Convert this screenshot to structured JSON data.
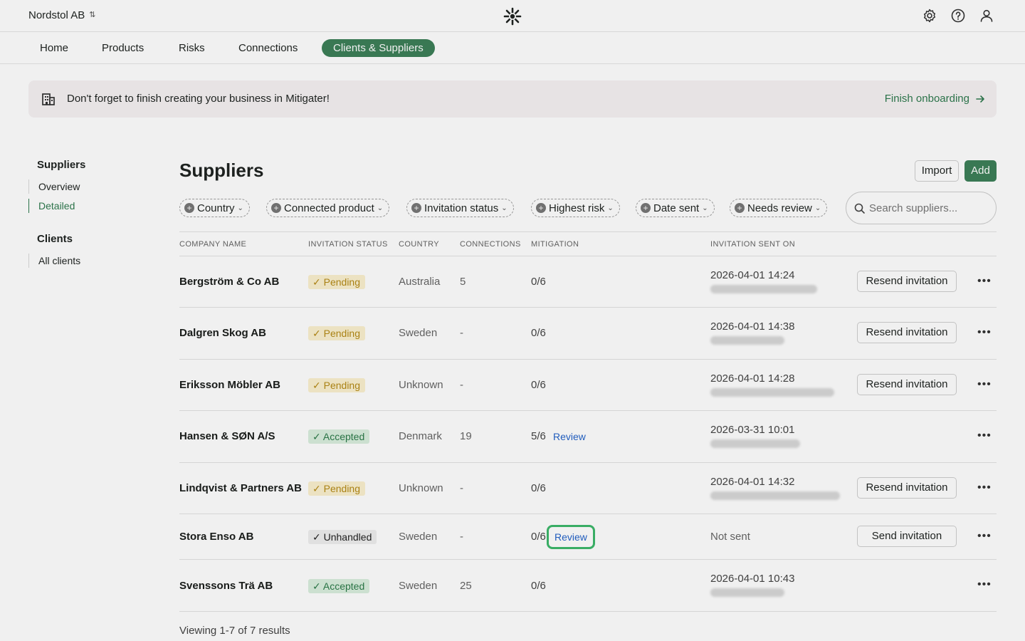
{
  "header": {
    "org_name": "Nordstol AB"
  },
  "nav": {
    "items": [
      "Home",
      "Products",
      "Risks",
      "Connections",
      "Clients & Suppliers"
    ],
    "active": "Clients & Suppliers"
  },
  "banner": {
    "text": "Don't forget to finish creating your business in Mitigater!",
    "link_label": "Finish onboarding"
  },
  "sidebar": {
    "suppliers_title": "Suppliers",
    "suppliers_items": [
      "Overview",
      "Detailed"
    ],
    "clients_title": "Clients",
    "clients_items": [
      "All clients"
    ]
  },
  "main": {
    "title": "Suppliers",
    "import_label": "Import",
    "add_label": "Add",
    "filters": [
      "Country",
      "Connected product",
      "Invitation status",
      "Highest risk",
      "Date sent",
      "Needs review"
    ],
    "search_placeholder": "Search suppliers...",
    "columns": [
      "COMPANY NAME",
      "INVITATION STATUS",
      "COUNTRY",
      "CONNECTIONS",
      "MITIGATION",
      "INVITATION SENT ON"
    ],
    "rows": [
      {
        "company": "Bergström & Co AB",
        "status": "Pending",
        "country": "Australia",
        "connections": "5",
        "mitigation": "0/6",
        "review": "",
        "sent_on": "2026-04-01 14:24",
        "action": "Resend invitation"
      },
      {
        "company": "Dalgren Skog AB",
        "status": "Pending",
        "country": "Sweden",
        "connections": "-",
        "mitigation": "0/6",
        "review": "",
        "sent_on": "2026-04-01 14:38",
        "action": "Resend invitation"
      },
      {
        "company": "Eriksson Möbler AB",
        "status": "Pending",
        "country": "Unknown",
        "connections": "-",
        "mitigation": "0/6",
        "review": "",
        "sent_on": "2026-04-01 14:28",
        "action": "Resend invitation"
      },
      {
        "company": "Hansen & SØN A/S",
        "status": "Accepted",
        "country": "Denmark",
        "connections": "19",
        "mitigation": "5/6",
        "review": "Review",
        "sent_on": "2026-03-31 10:01",
        "action": ""
      },
      {
        "company": "Lindqvist & Partners AB",
        "status": "Pending",
        "country": "Unknown",
        "connections": "-",
        "mitigation": "0/6",
        "review": "",
        "sent_on": "2026-04-01 14:32",
        "action": "Resend invitation"
      },
      {
        "company": "Stora Enso AB",
        "status": "Unhandled",
        "country": "Sweden",
        "connections": "-",
        "mitigation": "0/6",
        "review": "Review",
        "sent_on": "Not sent",
        "action": "Send invitation"
      },
      {
        "company": "Svenssons Trä AB",
        "status": "Accepted",
        "country": "Sweden",
        "connections": "25",
        "mitigation": "0/6",
        "review": "",
        "sent_on": "2026-04-01 10:43",
        "action": ""
      }
    ],
    "footer": "Viewing 1-7 of 7 results"
  },
  "colors": {
    "accent": "#3d8059",
    "pending": "#b58a16",
    "accepted": "#2b7a48",
    "link": "#2463c9",
    "focus_ring": "#3db86b"
  }
}
